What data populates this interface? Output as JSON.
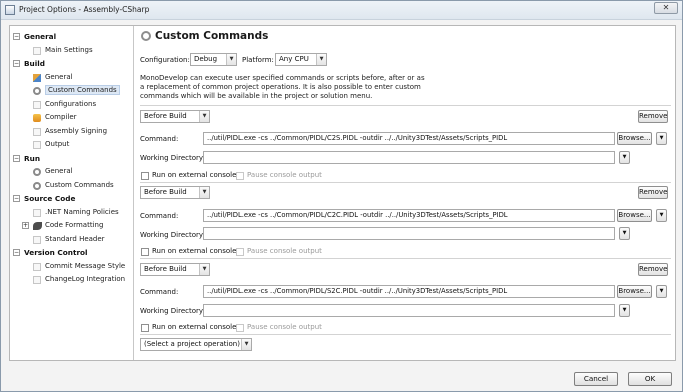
{
  "window": {
    "title": "Project Options - Assembly-CSharp",
    "close_glyph": "✕"
  },
  "sidebar": {
    "categories": [
      {
        "label": "General",
        "items": [
          {
            "label": "Main Settings"
          }
        ]
      },
      {
        "label": "Build",
        "items": [
          {
            "label": "General"
          },
          {
            "label": "Custom Commands",
            "selected": true
          },
          {
            "label": "Configurations"
          },
          {
            "label": "Compiler"
          },
          {
            "label": "Assembly Signing"
          },
          {
            "label": "Output"
          }
        ]
      },
      {
        "label": "Run",
        "items": [
          {
            "label": "General"
          },
          {
            "label": "Custom Commands"
          }
        ]
      },
      {
        "label": "Source Code",
        "items": [
          {
            "label": ".NET Naming Policies"
          },
          {
            "label": "Code Formatting"
          },
          {
            "label": "Standard Header"
          }
        ]
      },
      {
        "label": "Version Control",
        "items": [
          {
            "label": "Commit Message Style"
          },
          {
            "label": "ChangeLog Integration"
          }
        ]
      }
    ],
    "expander_glyph": "−",
    "plus_glyph": "+"
  },
  "main": {
    "title": "Custom Commands",
    "configuration_label": "Configuration:",
    "configuration_value": "Debug",
    "platform_label": "Platform:",
    "platform_value": "Any CPU",
    "description": "MonoDevelop can execute user specified commands or scripts before, after or as a replacement of common project operations. It is also possible to enter custom commands which will be available in the project or solution menu.",
    "arrow_glyph": "▼",
    "command_blocks": [
      {
        "operation": "Before Build",
        "remove_label": "Remove",
        "command_label": "Command:",
        "command_value": "../util/PIDL.exe -cs ../Common/PIDL/C2S.PIDL -outdir ../../Unity3DTest/Assets/Scripts_PIDL",
        "browse_label": "Browse...",
        "workdir_label": "Working Directory:",
        "workdir_value": "",
        "external_console_label": "Run on external console",
        "pause_output_label": "Pause console output"
      },
      {
        "operation": "Before Build",
        "remove_label": "Remove",
        "command_label": "Command:",
        "command_value": "../util/PIDL.exe -cs ../Common/PIDL/C2C.PIDL -outdir ../../Unity3DTest/Assets/Scripts_PIDL",
        "browse_label": "Browse...",
        "workdir_label": "Working Directory:",
        "workdir_value": "",
        "external_console_label": "Run on external console",
        "pause_output_label": "Pause console output"
      },
      {
        "operation": "Before Build",
        "remove_label": "Remove",
        "command_label": "Command:",
        "command_value": "../util/PIDL.exe -cs ../Common/PIDL/S2C.PIDL -outdir ../../Unity3DTest/Assets/Scripts_PIDL",
        "browse_label": "Browse...",
        "workdir_label": "Working Directory:",
        "workdir_value": "",
        "external_console_label": "Run on external console",
        "pause_output_label": "Pause console output"
      }
    ],
    "select_operation_value": "(Select a project operation)"
  },
  "footer": {
    "cancel_label": "Cancel",
    "ok_label": "OK"
  }
}
